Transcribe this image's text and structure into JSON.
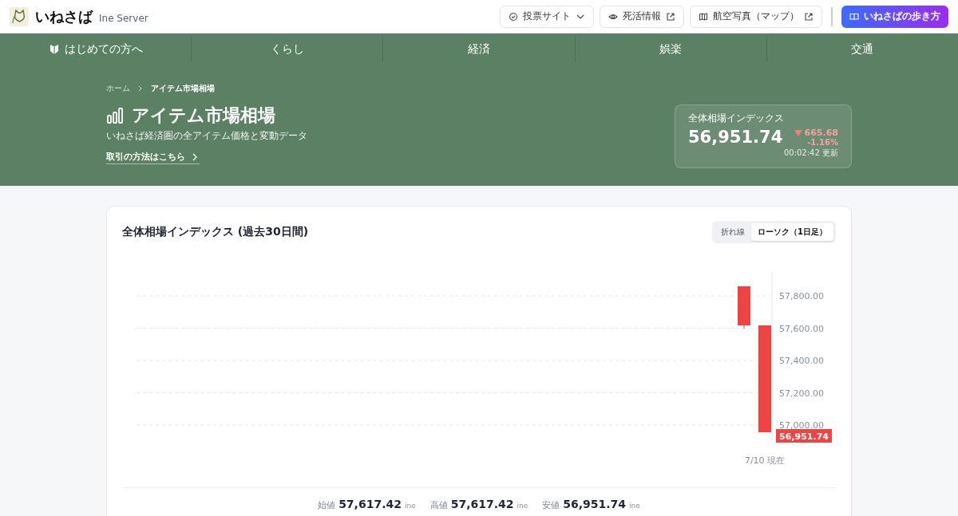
{
  "header": {
    "logo_text": "いねさば",
    "subtitle": "Ine Server",
    "buttons": [
      {
        "kind": "dropdown",
        "label": "投票サイト"
      },
      {
        "kind": "eyelink",
        "label": "死活情報"
      },
      {
        "kind": "maplink",
        "label": "航空写真（マップ）"
      },
      {
        "kind": "primary",
        "label": "いねさばの歩き方"
      }
    ]
  },
  "nav": [
    {
      "label": "はじめての方へ",
      "kind": "beginner"
    },
    {
      "label": "くらし",
      "kind": "plain"
    },
    {
      "label": "経済",
      "kind": "plain"
    },
    {
      "label": "娯楽",
      "kind": "plain"
    },
    {
      "label": "交通",
      "kind": "plain"
    }
  ],
  "breadcrumb": [
    "ホーム",
    "アイテム市場相場"
  ],
  "hero": {
    "title": "アイテム市場相場",
    "subtitle": "いねさば経済圏の全アイテム価格と変動データ",
    "link": "取引の方法はこちら"
  },
  "index_card": {
    "label": "全体相場インデックス",
    "value": "56,951.74",
    "change": "665.68",
    "percent": "-1.16%",
    "updated": "00:02:42 更新"
  },
  "chart_card": {
    "title": "全体相場インデックス (過去30日間)",
    "toggle": [
      {
        "label": "折れ線",
        "selected": false
      },
      {
        "label": "ローソク（1日足）",
        "selected": true
      }
    ],
    "chart": {
      "y_labels": [
        "57,800.00",
        "57,600.00",
        "57,400.00",
        "57,200.00",
        "57,000.00"
      ],
      "price_tag": "56,951.74",
      "x_label": "7/10 現在"
    },
    "stats": [
      {
        "label": "始値",
        "value": "57,617.42",
        "unit": "ine"
      },
      {
        "label": "高値",
        "value": "57,617.42",
        "unit": "ine"
      },
      {
        "label": "安値",
        "value": "56,951.74",
        "unit": "ine"
      }
    ]
  }
}
